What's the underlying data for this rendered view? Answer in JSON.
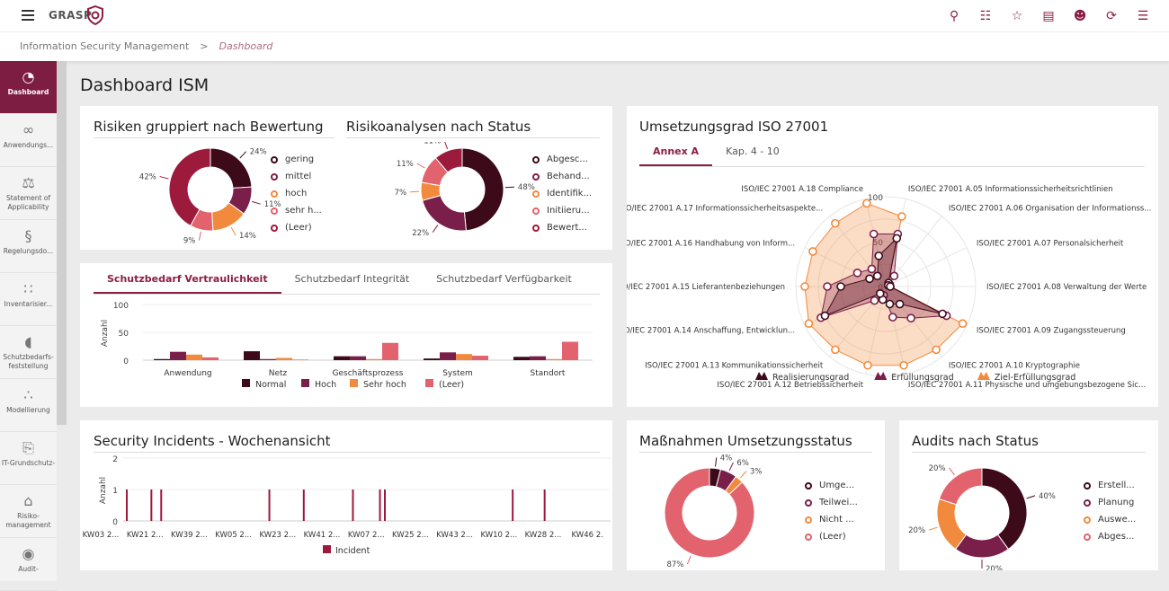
{
  "app": {
    "logo": "GRASP"
  },
  "header": {
    "icons": [
      "search-icon",
      "group-scan-icon",
      "star-icon",
      "document-info-icon",
      "user-settings-icon",
      "refresh-icon",
      "list-icon"
    ]
  },
  "breadcrumb": {
    "parent": "Information Security Management",
    "sep": ">",
    "current": "Dashboard"
  },
  "sidebar": {
    "items": [
      {
        "label": "Dashboard",
        "icon": "pie-chart-icon",
        "active": true
      },
      {
        "label": "Anwendungs...",
        "icon": "glasses-icon"
      },
      {
        "label": "Statement of Applicability",
        "icon": "scale-icon"
      },
      {
        "label": "Regelungsdo...",
        "icon": "paragraph-book-icon"
      },
      {
        "label": "Inventarisier...",
        "icon": "network-icon"
      },
      {
        "label": "Schutzbedarfs-feststellung",
        "icon": "shield-icon"
      },
      {
        "label": "Modellierung",
        "icon": "blocks-icon"
      },
      {
        "label": "IT-Grundschutz-",
        "icon": "clipboard-icon"
      },
      {
        "label": "Risiko-management",
        "icon": "house-icon"
      },
      {
        "label": "Audit-",
        "icon": "eye-icon"
      }
    ]
  },
  "page": {
    "title": "Dashboard ISM"
  },
  "colors": {
    "c1": "#3d0a19",
    "c2": "#7a1f49",
    "c3": "#f28a3e",
    "c4": "#e2636e",
    "c5": "#9c1a3c"
  },
  "chart_data": [
    {
      "id": "risiken",
      "type": "pie",
      "title": "Risiken gruppiert nach Bewertung",
      "categories": [
        "gering",
        "mittel",
        "hoch",
        "sehr h...",
        "(Leer)"
      ],
      "values": [
        24,
        11,
        14,
        9,
        42
      ],
      "labels": [
        "24%",
        "11%",
        "14%",
        "9%",
        "42%"
      ]
    },
    {
      "id": "analysen",
      "type": "pie",
      "title": "Risikoanalysen nach Status",
      "categories": [
        "Abgesc...",
        "Behand...",
        "Identifik...",
        "Initiieru...",
        "Bewert..."
      ],
      "values": [
        48,
        22,
        7,
        11,
        11
      ],
      "labels": [
        "48%",
        "22%",
        "7%",
        "11%",
        "11%"
      ]
    },
    {
      "id": "schutz",
      "type": "bar",
      "tabs": [
        "Schutzbedarf Vertraulichkeit",
        "Schutzbedarf Integrität",
        "Schutzbedarf Verfügbarkeit"
      ],
      "ylabel": "Anzahl",
      "ylim": [
        0,
        100
      ],
      "yticks": [
        "0",
        "50",
        "100"
      ],
      "categories": [
        "Anwendung",
        "Netz",
        "Geschäftsprozess",
        "System",
        "Standort"
      ],
      "series": [
        {
          "name": "Normal",
          "values": [
            2,
            16,
            7,
            3,
            6
          ]
        },
        {
          "name": "Hoch",
          "values": [
            15,
            2,
            7,
            14,
            7
          ]
        },
        {
          "name": "Sehr hoch",
          "values": [
            10,
            4,
            2,
            11,
            2
          ]
        },
        {
          "name": "(Leer)",
          "values": [
            5,
            1,
            31,
            8,
            33
          ]
        }
      ]
    },
    {
      "id": "iso",
      "type": "radar",
      "title": "Umsetzungsgrad ISO 27001",
      "tabs": [
        "Annex A",
        "Kap. 4 - 10"
      ],
      "rlim": [
        0,
        100
      ],
      "rticks": [
        "0",
        "50",
        "100"
      ],
      "categories": [
        "ISO/IEC 27001 A.05 Informationssicherheitsrichtlinien",
        "ISO/IEC 27001 A.06 Organisation der Informationss...",
        "ISO/IEC 27001 A.07 Personalsicherheit",
        "ISO/IEC 27001 A.08 Verwaltung der Werte",
        "ISO/IEC 27001 A.09 Zugangssteuerung",
        "ISO/IEC 27001 A.10 Kryptographie",
        "ISO/IEC 27001 A.11 Physische und umgebungsbezogene Sic...",
        "ISO/IEC 27001 A.12 Betriebssicherheit",
        "ISO/IEC 27001 A.13 Kommunikationssicherheit",
        "ISO/IEC 27001 A.14 Anschaffung, Entwicklun...",
        "ISO/IEC 27001 A.15 Lieferantenbeziehungen",
        "ISO/IEC 27001 A.16 Handhabung von Inform...",
        "ISO/IEC 27001 A.17 Informationssicherheitsaspekte...",
        "ISO/IEC 27001 A.18 Compliance"
      ],
      "series": [
        {
          "name": "Realisierungsgrad",
          "values": [
            55,
            5,
            3,
            5,
            70,
            25,
            20,
            15,
            10,
            75,
            50,
            20,
            15,
            35
          ]
        },
        {
          "name": "Erfüllungsgrad",
          "values": [
            60,
            15,
            5,
            5,
            75,
            45,
            35,
            10,
            20,
            80,
            65,
            35,
            25,
            60
          ]
        },
        {
          "name": "Ziel-Erfüllungsgrad",
          "values": [
            80,
            5,
            5,
            5,
            95,
            90,
            90,
            90,
            90,
            95,
            90,
            90,
            90,
            95
          ]
        }
      ]
    },
    {
      "id": "incidents",
      "type": "bar",
      "title": "Security Incidents - Wochenansicht",
      "ylabel": "Anzahl",
      "ylim": [
        0,
        2
      ],
      "yticks": [
        "0",
        "1",
        "2"
      ],
      "xticks": [
        "KW03 2...",
        "KW21 2...",
        "KW39 2...",
        "KW05 2...",
        "KW23 2...",
        "KW41 2...",
        "KW07 2...",
        "KW25 2...",
        "KW43 2...",
        "KW10 2...",
        "KW28 2...",
        "KW46 2."
      ],
      "series": [
        {
          "name": "Incident",
          "weeks_after_first_tick": [
            0,
            10,
            14,
            58,
            72,
            92,
            103,
            105,
            157,
            170
          ],
          "values": [
            1,
            1,
            1,
            1,
            1,
            1,
            1,
            1,
            1,
            1
          ]
        }
      ]
    },
    {
      "id": "massnahmen",
      "type": "pie",
      "title": "Maßnahmen Umsetzungsstatus",
      "categories": [
        "Umge...",
        "Teilwei...",
        "Nicht ...",
        "(Leer)"
      ],
      "values": [
        4,
        6,
        3,
        87
      ],
      "labels": [
        "4%",
        "6%",
        "3%",
        "87%"
      ]
    },
    {
      "id": "audits",
      "type": "pie",
      "title": "Audits nach Status",
      "categories": [
        "Erstell...",
        "Planung",
        "Auswe...",
        "Abges..."
      ],
      "values": [
        40,
        20,
        20,
        20
      ],
      "labels": [
        "40%",
        "20%",
        "20%",
        "20%"
      ]
    }
  ]
}
